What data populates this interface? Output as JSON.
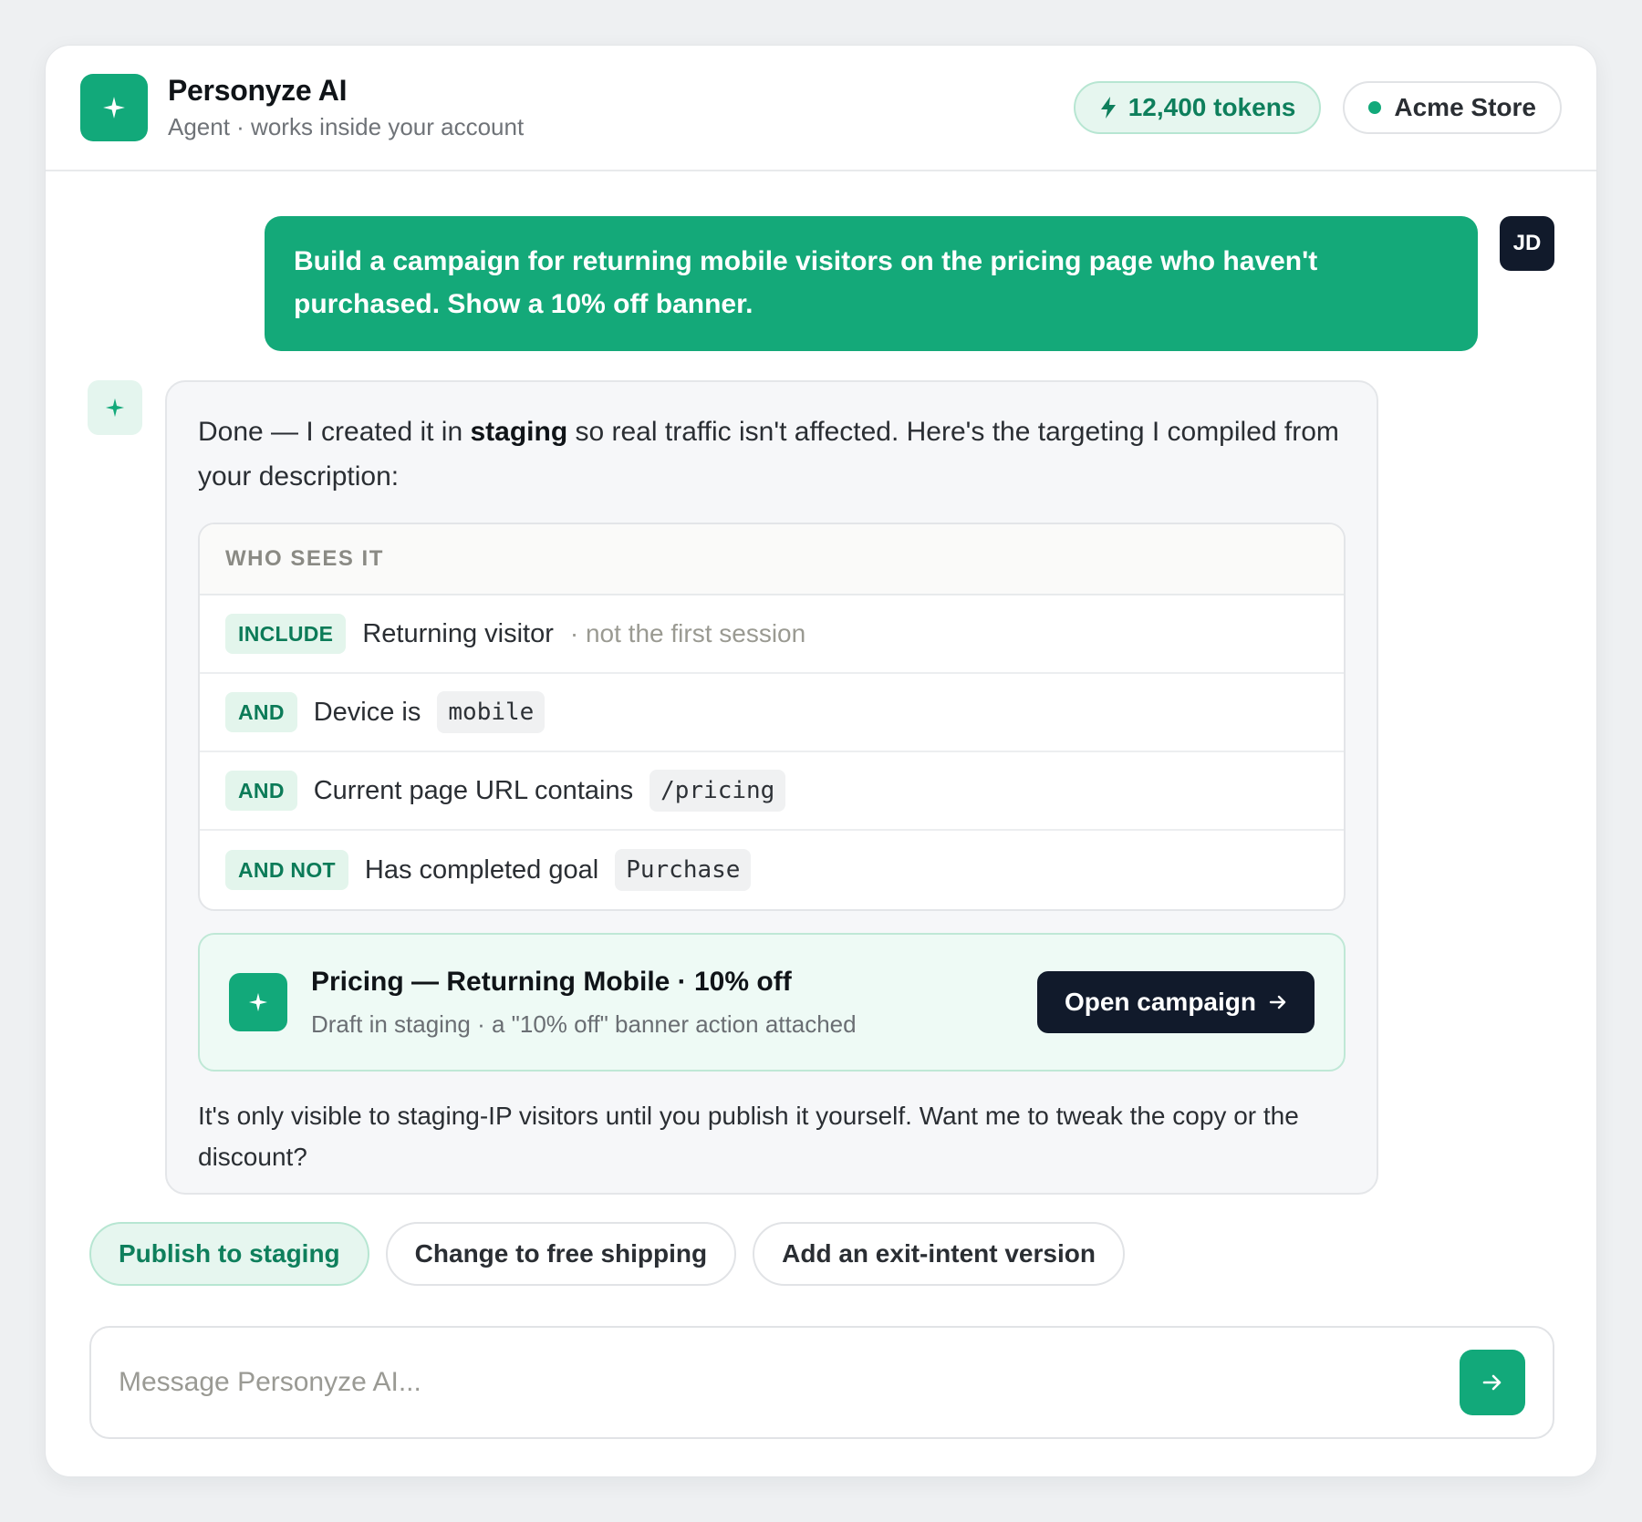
{
  "header": {
    "title": "Personyze AI",
    "subtitle": "Agent · works inside your account",
    "tokens": "12,400 tokens",
    "store": "Acme Store"
  },
  "user_message": {
    "text": "Build a campaign for returning mobile visitors on the pricing page who haven't purchased. Show a 10% off banner.",
    "avatar_initials": "JD"
  },
  "assistant": {
    "intro_before": "Done — I created it in ",
    "intro_bold": "staging",
    "intro_after": " so real traffic isn't affected. Here's the targeting I compiled from your description:",
    "targeting": {
      "heading": "WHO SEES IT",
      "rules": [
        {
          "op": "INCLUDE",
          "text": "Returning visitor",
          "note": "· not the first session",
          "code": ""
        },
        {
          "op": "AND",
          "text": "Device is",
          "note": "",
          "code": "mobile"
        },
        {
          "op": "AND",
          "text": "Current page URL contains",
          "note": "",
          "code": "/pricing"
        },
        {
          "op": "AND NOT",
          "text": "Has completed goal",
          "note": "",
          "code": "Purchase"
        }
      ]
    },
    "campaign": {
      "title": "Pricing — Returning Mobile · 10% off",
      "subtitle": "Draft in staging · a \"10% off\" banner action attached",
      "button": "Open campaign"
    },
    "outro": "It's only visible to staging-IP visitors until you publish it yourself. Want me to tweak the copy or the discount?"
  },
  "suggestions": [
    "Publish to staging",
    "Change to free shipping",
    "Add an exit-intent version"
  ],
  "composer": {
    "placeholder": "Message Personyze AI..."
  },
  "colors": {
    "brand": "#12a97a",
    "dark": "#111a2b"
  },
  "icons": {
    "logo": "sparkle-icon",
    "tokens": "bolt-icon",
    "send": "arrow-right-icon"
  }
}
